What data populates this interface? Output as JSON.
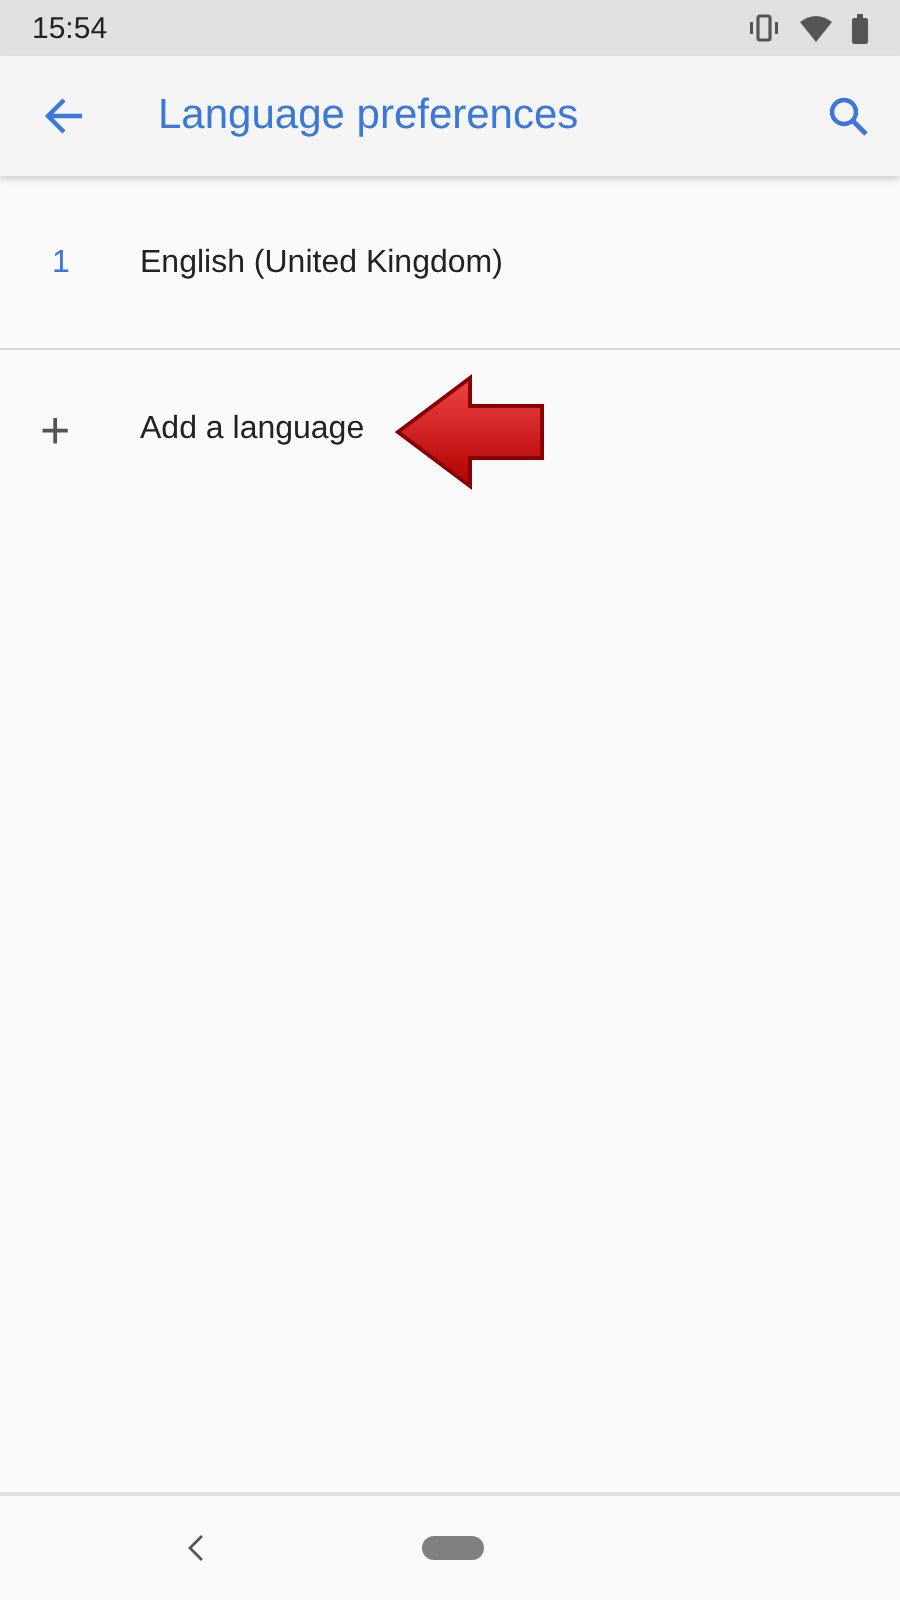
{
  "status_bar": {
    "time": "15:54"
  },
  "app_bar": {
    "title": "Language preferences"
  },
  "languages": [
    {
      "number": "1",
      "name": "English (United Kingdom)"
    }
  ],
  "add_item": {
    "icon": "+",
    "label": "Add a language"
  }
}
